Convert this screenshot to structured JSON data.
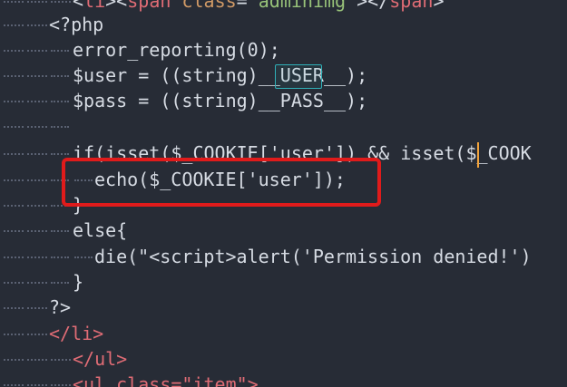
{
  "editor": {
    "colors": {
      "background": "#272c36",
      "text": "#d6dbe3",
      "tag": "#e06c75",
      "attr": "#d19a66",
      "string": "#98c379",
      "function": "#61afef",
      "guide": "#5a6172",
      "match_highlight": "#2fb0b8",
      "cursor": "#f0a23b",
      "annotation": "#e01b1b"
    },
    "lines": [
      {
        "code": "<li><span class=\"adminimg\"></span>"
      },
      {
        "code": "<?php"
      },
      {
        "code": "error_reporting(0);"
      },
      {
        "code": "$user = ((string)__USER__);"
      },
      {
        "code": "$pass = ((string)__PASS__);"
      },
      {
        "code": ""
      },
      {
        "code": "if(isset($_COOKIE['user']) && isset($_COOK"
      },
      {
        "code": "echo($_COOKIE['user']);"
      },
      {
        "code": "}"
      },
      {
        "code": "else{"
      },
      {
        "code": "die(\"<script>alert('Permission denied!')"
      },
      {
        "code": "}"
      },
      {
        "code": "?>"
      },
      {
        "code": "</li>"
      },
      {
        "code": "</ul>"
      },
      {
        "code": "<ul class=\"item\">"
      }
    ]
  }
}
